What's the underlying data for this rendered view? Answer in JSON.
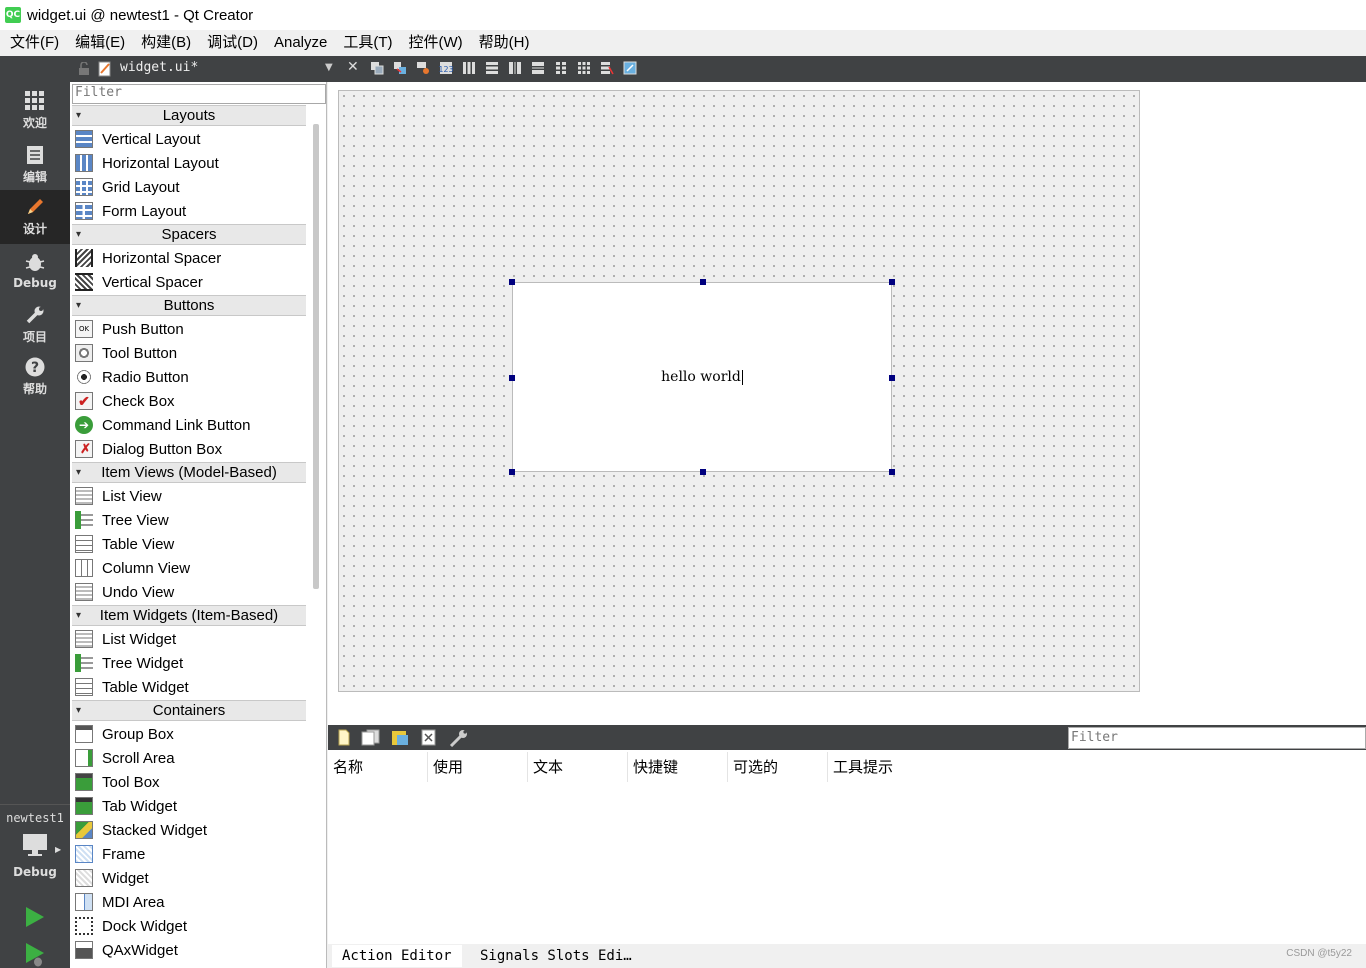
{
  "window": {
    "title": "widget.ui @ newtest1 - Qt Creator",
    "app_icon_text": "QC"
  },
  "menubar": [
    "文件(F)",
    "编辑(E)",
    "构建(B)",
    "调试(D)",
    "Analyze",
    "工具(T)",
    "控件(W)",
    "帮助(H)"
  ],
  "modes": [
    {
      "label": "欢迎",
      "icon": "grid-icon"
    },
    {
      "label": "编辑",
      "icon": "document-icon"
    },
    {
      "label": "设计",
      "icon": "pencil-icon",
      "active": true
    },
    {
      "label": "Debug",
      "icon": "bug-icon"
    },
    {
      "label": "项目",
      "icon": "wrench-icon"
    },
    {
      "label": "帮助",
      "icon": "help-icon"
    }
  ],
  "kit": {
    "project": "newtest1",
    "build": "Debug"
  },
  "document": {
    "name": "widget.ui*"
  },
  "widgetbox": {
    "filter_placeholder": "Filter",
    "categories": [
      {
        "name": "Layouts",
        "items": [
          "Vertical Layout",
          "Horizontal Layout",
          "Grid Layout",
          "Form Layout"
        ]
      },
      {
        "name": "Spacers",
        "items": [
          "Horizontal Spacer",
          "Vertical Spacer"
        ]
      },
      {
        "name": "Buttons",
        "items": [
          "Push Button",
          "Tool Button",
          "Radio Button",
          "Check Box",
          "Command Link Button",
          "Dialog Button Box"
        ]
      },
      {
        "name": "Item Views (Model-Based)",
        "items": [
          "List View",
          "Tree View",
          "Table View",
          "Column View",
          "Undo View"
        ]
      },
      {
        "name": "Item Widgets (Item-Based)",
        "items": [
          "List Widget",
          "Tree Widget",
          "Table Widget"
        ]
      },
      {
        "name": "Containers",
        "items": [
          "Group Box",
          "Scroll Area",
          "Tool Box",
          "Tab Widget",
          "Stacked Widget",
          "Frame",
          "Widget",
          "MDI Area",
          "Dock Widget",
          "QAxWidget"
        ]
      }
    ]
  },
  "form": {
    "label_text": "hello world"
  },
  "action_editor": {
    "filter_placeholder": "Filter",
    "columns": [
      "名称",
      "使用",
      "文本",
      "快捷键",
      "可选的",
      "工具提示"
    ]
  },
  "bottom_tabs": [
    "Action Editor",
    "Signals  Slots Edi…"
  ],
  "watermark": "CSDN @t5y22",
  "colors": {
    "sidebar": "#404244",
    "sidebar_active": "#262626",
    "handle": "#00007f",
    "run_green": "#3cb043"
  }
}
